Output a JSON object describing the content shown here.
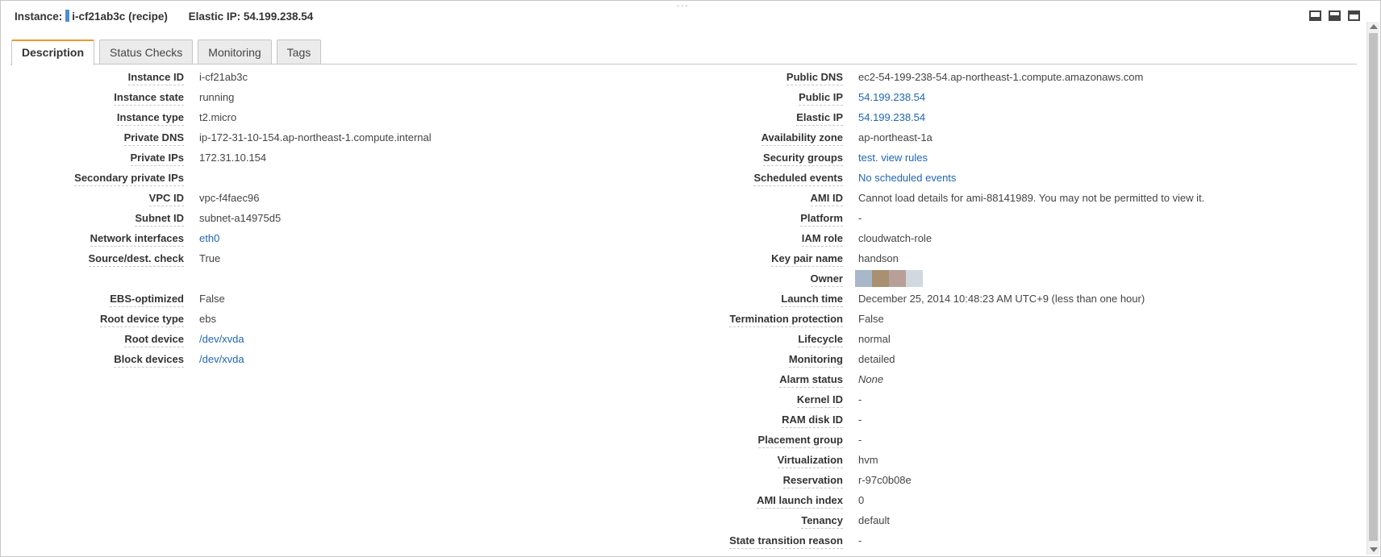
{
  "header": {
    "instance_label": "Instance:",
    "instance_value": "i-cf21ab3c (recipe)",
    "elastic_label": "Elastic IP:",
    "elastic_value": "54.199.238.54",
    "instance_color": "#4c8ecf"
  },
  "grip": "◦◦◦",
  "view_icons": [
    "bottom-panel-icon",
    "half-panel-icon",
    "full-panel-icon"
  ],
  "tabs": [
    {
      "label": "Description",
      "active": true
    },
    {
      "label": "Status Checks",
      "active": false
    },
    {
      "label": "Monitoring",
      "active": false
    },
    {
      "label": "Tags",
      "active": false
    }
  ],
  "left": [
    {
      "label": "Instance ID",
      "value": "i-cf21ab3c"
    },
    {
      "label": "Instance state",
      "value": "running"
    },
    {
      "label": "Instance type",
      "value": "t2.micro"
    },
    {
      "label": "Private DNS",
      "value": "ip-172-31-10-154.ap-northeast-1.compute.internal"
    },
    {
      "label": "Private IPs",
      "value": "172.31.10.154"
    },
    {
      "label": "Secondary private IPs",
      "value": ""
    },
    {
      "label": "VPC ID",
      "value": "vpc-f4faec96"
    },
    {
      "label": "Subnet ID",
      "value": "subnet-a14975d5"
    },
    {
      "label": "Network interfaces",
      "value": "eth0"
    },
    {
      "label": "Source/dest. check",
      "value": "True"
    },
    {
      "label": "EBS-optimized",
      "value": "False"
    },
    {
      "label": "Root device type",
      "value": "ebs"
    },
    {
      "label": "Root device",
      "value": "/dev/xvda"
    },
    {
      "label": "Block devices",
      "value": "/dev/xvda"
    }
  ],
  "right": [
    {
      "label": "Public DNS",
      "value": "ec2-54-199-238-54.ap-northeast-1.compute.amazonaws.com"
    },
    {
      "label": "Public IP",
      "value": "54.199.238.54"
    },
    {
      "label": "Elastic IP",
      "value": "54.199.238.54"
    },
    {
      "label": "Availability zone",
      "value": "ap-northeast-1a"
    },
    {
      "label": "Security groups",
      "value": "test",
      "value2": "view rules",
      "sep": ". "
    },
    {
      "label": "Scheduled events",
      "value": "No scheduled events"
    },
    {
      "label": "AMI ID",
      "value": "Cannot load details for ami-88141989. You may not be permitted to view it."
    },
    {
      "label": "Platform",
      "value": "-"
    },
    {
      "label": "IAM role",
      "value": "cloudwatch-role"
    },
    {
      "label": "Key pair name",
      "value": "handson"
    },
    {
      "label": "Owner",
      "owner_colors": [
        "#a8b8c8",
        "#a89070",
        "#b8a098",
        "#d0d8e0"
      ]
    },
    {
      "label": "Launch time",
      "value": "December 25, 2014 10:48:23 AM UTC+9 (less than one hour)"
    },
    {
      "label": "Termination protection",
      "value": "False"
    },
    {
      "label": "Lifecycle",
      "value": "normal"
    },
    {
      "label": "Monitoring",
      "value": "detailed"
    },
    {
      "label": "Alarm status",
      "value": "None"
    },
    {
      "label": "Kernel ID",
      "value": "-"
    },
    {
      "label": "RAM disk ID",
      "value": "-"
    },
    {
      "label": "Placement group",
      "value": "-"
    },
    {
      "label": "Virtualization",
      "value": "hvm"
    },
    {
      "label": "Reservation",
      "value": "r-97c0b08e"
    },
    {
      "label": "AMI launch index",
      "value": "0"
    },
    {
      "label": "Tenancy",
      "value": "default"
    },
    {
      "label": "State transition reason",
      "value": "-"
    }
  ],
  "colors": {
    "link": "#1f66b3",
    "active_tab_accent": "#e89b2c"
  }
}
